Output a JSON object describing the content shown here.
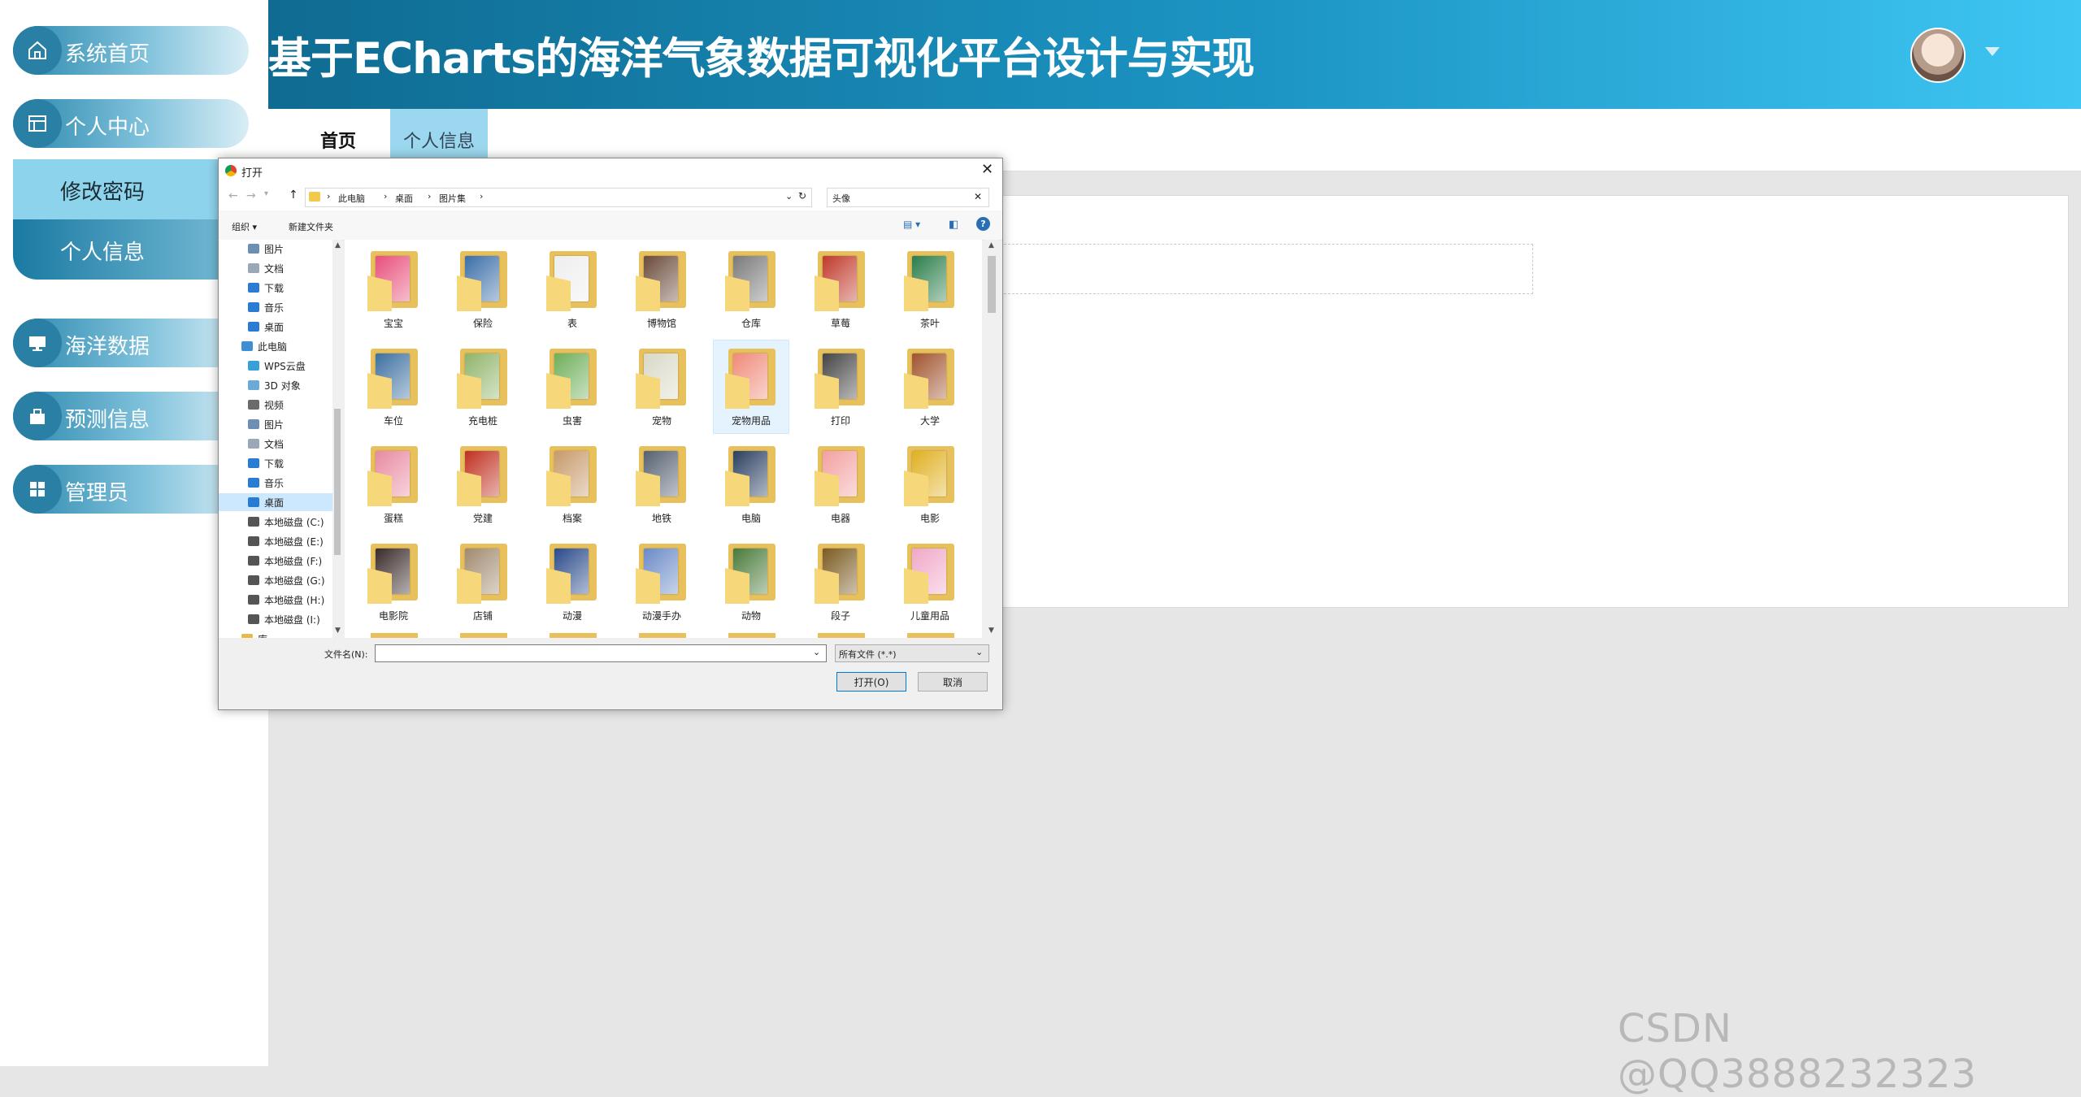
{
  "header": {
    "title": "基于ECharts的海洋气象数据可视化平台设计与实现"
  },
  "sidebar": {
    "menu": [
      {
        "label": "系统首页"
      },
      {
        "label": "个人中心"
      },
      {
        "label": "海洋数据"
      },
      {
        "label": "预测信息"
      },
      {
        "label": "管理员"
      }
    ],
    "submenu": [
      {
        "label": "修改密码"
      },
      {
        "label": "个人信息"
      }
    ]
  },
  "tabs": [
    {
      "label": "首页"
    },
    {
      "label": "个人信息"
    }
  ],
  "dialog": {
    "title": "打开",
    "breadcrumb": [
      "此电脑",
      "桌面",
      "图片集"
    ],
    "search": "头像",
    "organize": "组织 ▾",
    "new_folder": "新建文件夹",
    "nav_items": [
      "图片",
      "文档",
      "下载",
      "音乐",
      "桌面",
      "此电脑",
      "WPS云盘",
      "3D 对象",
      "视频",
      "图片",
      "文档",
      "下载",
      "音乐",
      "桌面",
      "本地磁盘 (C:)",
      "本地磁盘 (E:)",
      "本地磁盘 (F:)",
      "本地磁盘 (G:)",
      "本地磁盘 (H:)",
      "本地磁盘 (I:)",
      "库"
    ],
    "folders": [
      "宝宝",
      "保险",
      "表",
      "博物馆",
      "仓库",
      "草莓",
      "茶叶",
      "车位",
      "充电桩",
      "虫害",
      "宠物",
      "宠物用品",
      "打印",
      "大学",
      "蛋糕",
      "党建",
      "档案",
      "地铁",
      "电脑",
      "电器",
      "电影",
      "电影院",
      "店铺",
      "动漫",
      "动漫手办",
      "动物",
      "段子",
      "儿童用品"
    ],
    "filename_label": "文件名(N):",
    "filename_value": "",
    "filetype": "所有文件 (*.*)",
    "open_button": "打开(O)",
    "cancel_button": "取消"
  },
  "watermark": "CSDN @QQ3888232323",
  "colors": {
    "header_start": "#0f6b91",
    "header_end": "#3fc6f3",
    "menu_circle": "#2a7fa4",
    "submenu_active": "#8ed3ec"
  }
}
